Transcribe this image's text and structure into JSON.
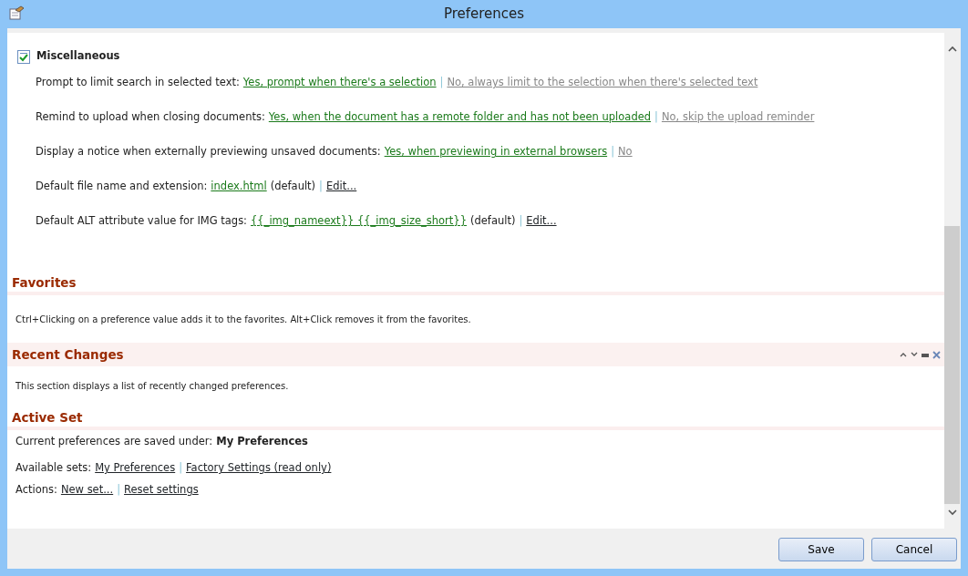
{
  "window": {
    "title": "Preferences"
  },
  "miscellaneous": {
    "title": "Miscellaneous",
    "checked": true,
    "rows": [
      {
        "parts": [
          {
            "kind": "label",
            "text": "Prompt to limit search in selected text:"
          },
          {
            "kind": "selected",
            "text": "Yes, prompt when there's a selection"
          },
          {
            "kind": "separator",
            "text": "|"
          },
          {
            "kind": "option",
            "text": "No, always limit to the selection when there's selected text"
          }
        ]
      },
      {
        "parts": [
          {
            "kind": "label",
            "text": "Remind to upload when closing documents:"
          },
          {
            "kind": "selected",
            "text": "Yes, when the document has a remote folder and has not been uploaded"
          },
          {
            "kind": "separator",
            "text": "|"
          },
          {
            "kind": "option",
            "text": "No, skip the upload reminder"
          }
        ]
      },
      {
        "parts": [
          {
            "kind": "label",
            "text": "Display a notice when externally previewing unsaved documents:"
          },
          {
            "kind": "selected",
            "text": "Yes, when previewing in external browsers"
          },
          {
            "kind": "separator",
            "text": "|"
          },
          {
            "kind": "option",
            "text": "No"
          }
        ]
      },
      {
        "parts": [
          {
            "kind": "label",
            "text": "Default file name and extension:"
          },
          {
            "kind": "selected",
            "text": "index.html"
          },
          {
            "kind": "note",
            "text": "(default)"
          },
          {
            "kind": "separator",
            "text": "|"
          },
          {
            "kind": "action",
            "text": "Edit..."
          }
        ]
      },
      {
        "parts": [
          {
            "kind": "label",
            "text": "Default ALT attribute value for IMG tags:"
          },
          {
            "kind": "selected",
            "text": "{{_img_nameext}} {{_img_size_short}}"
          },
          {
            "kind": "note",
            "text": "(default)"
          },
          {
            "kind": "separator",
            "text": "|"
          },
          {
            "kind": "action",
            "text": "Edit..."
          }
        ]
      }
    ]
  },
  "favorites": {
    "title": "Favorites",
    "text": "Ctrl+Clicking on a preference value adds it to the favorites. Alt+Click removes it from the favorites."
  },
  "recent_changes": {
    "title": "Recent Changes",
    "text": "This section displays a list of recently changed preferences."
  },
  "active_set": {
    "title": "Active Set",
    "lines": [
      {
        "parts": [
          {
            "kind": "label",
            "text": "Current preferences are saved under:"
          },
          {
            "kind": "bold",
            "text": "My Preferences"
          }
        ]
      },
      {
        "parts": [
          {
            "kind": "label",
            "text": "Available sets:"
          },
          {
            "kind": "link",
            "text": "My Preferences"
          },
          {
            "kind": "separator",
            "text": "|"
          },
          {
            "kind": "action",
            "text": "Factory Settings (read only)"
          }
        ]
      },
      {
        "parts": [
          {
            "kind": "label",
            "text": "Actions:"
          },
          {
            "kind": "action",
            "text": "New set..."
          },
          {
            "kind": "separator",
            "text": "|"
          },
          {
            "kind": "action",
            "text": "Reset settings"
          }
        ]
      }
    ]
  },
  "buttons": [
    "Save",
    "Cancel"
  ]
}
